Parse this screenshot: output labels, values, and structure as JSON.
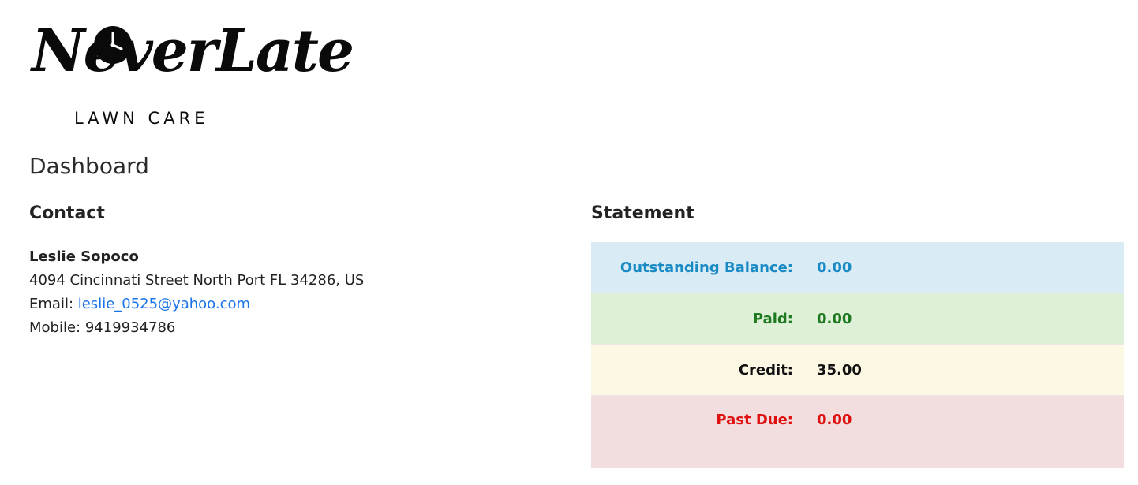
{
  "brand": {
    "logo_script": "NeverLate",
    "logo_sub": "LAWN CARE"
  },
  "page": {
    "title": "Dashboard"
  },
  "contact": {
    "heading": "Contact",
    "name": "Leslie Sopoco",
    "address": "4094 Cincinnati Street North Port FL 34286, US",
    "email_label": "Email: ",
    "email": "leslie_0525@yahoo.com",
    "mobile_label": "Mobile: ",
    "mobile": "9419934786"
  },
  "statement": {
    "heading": "Statement",
    "rows": [
      {
        "label": "Outstanding Balance:",
        "value": "0.00",
        "bg": "#d9ecf5",
        "color": "#1a8ac4"
      },
      {
        "label": "Paid:",
        "value": "0.00",
        "bg": "#dff0d8",
        "color": "#1e7a1e"
      },
      {
        "label": "Credit:",
        "value": "35.00",
        "bg": "#fcf8e3",
        "color": "#111111"
      },
      {
        "label": "Past Due:",
        "value": "0.00",
        "bg": "#f2dede",
        "color": "#e01010"
      }
    ]
  },
  "icons": {
    "logo_clock": "clock-icon"
  }
}
